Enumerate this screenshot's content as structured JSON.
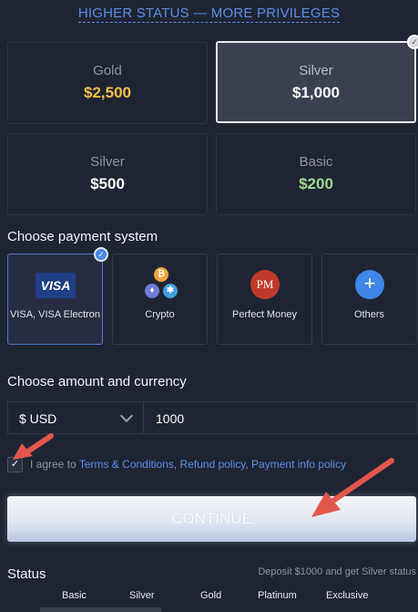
{
  "header": {
    "link_text": "HIGHER STATUS — MORE PRIVILEGES"
  },
  "plans": [
    {
      "name": "Gold",
      "amount": "$2,500",
      "color": "#f0c048"
    },
    {
      "name": "Silver",
      "amount": "$1,000",
      "color": "#ffffff"
    },
    {
      "name": "Silver",
      "amount": "$500",
      "color": "#ffffff"
    },
    {
      "name": "Basic",
      "amount": "$200",
      "color": "#9fd98f"
    }
  ],
  "payment": {
    "title": "Choose payment system",
    "methods": [
      {
        "label": "VISA, VISA Electron",
        "logo": "VISA"
      },
      {
        "label": "Crypto",
        "logo": "crypto-coins-icon"
      },
      {
        "label": "Perfect Money",
        "logo": "PM"
      },
      {
        "label": "Others",
        "logo": "+"
      }
    ]
  },
  "amount": {
    "title": "Choose amount and currency",
    "currency": "$ USD",
    "value": "1000"
  },
  "agreement": {
    "prefix": "I agree to ",
    "terms": "Terms & Conditions",
    "refund": "Refund policy",
    "payinfo": "Payment info policy",
    "sep": ", "
  },
  "continue_label": "CONTINUE",
  "status": {
    "title": "Status",
    "note": "Deposit $1000 and get Silver status",
    "levels": [
      "Basic",
      "Silver",
      "Gold",
      "Platinum",
      "Exclusive"
    ]
  },
  "colors": {
    "accent": "#4a86e8",
    "arrow": "#e2574c"
  }
}
